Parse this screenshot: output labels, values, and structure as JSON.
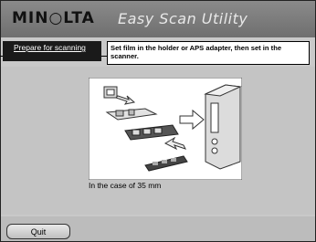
{
  "header": {
    "logo_text": "MIN○LTA",
    "app_title": "Easy Scan Utility"
  },
  "step": {
    "label": "Prepare for scanning",
    "instruction": "Set film in the holder or APS adapter, then set in the scanner."
  },
  "illustration": {
    "caption": "In the case of 35 mm"
  },
  "footer": {
    "quit_label": "Quit"
  }
}
